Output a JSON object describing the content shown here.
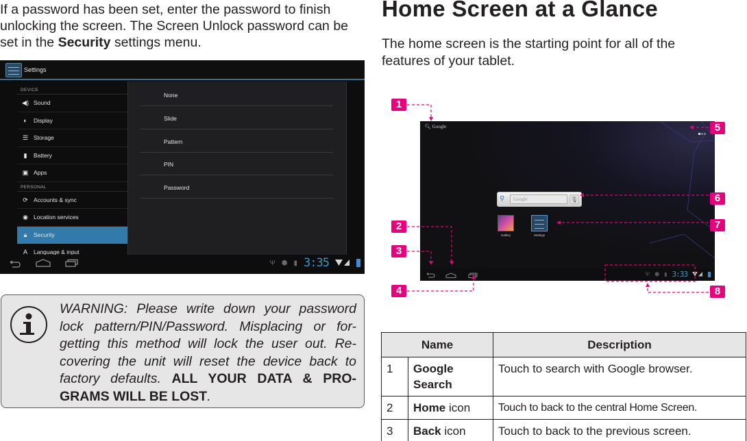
{
  "left": {
    "intro": {
      "part1": "If a password has been set, enter the password to finish unlocking the screen. The Screen Unlock password can be set in the ",
      "bold": "Security",
      "part2": " settings menu."
    },
    "settings_screenshot": {
      "actionbar_title": "Settings",
      "sections": [
        {
          "header": "DEVICE",
          "items": [
            {
              "label": "Sound",
              "icon": "speaker-icon"
            },
            {
              "label": "Display",
              "icon": "brightness-icon"
            },
            {
              "label": "Storage",
              "icon": "storage-icon"
            },
            {
              "label": "Battery",
              "icon": "battery-icon"
            },
            {
              "label": "Apps",
              "icon": "apps-icon"
            }
          ]
        },
        {
          "header": "PERSONAL",
          "items": [
            {
              "label": "Accounts & sync",
              "icon": "sync-icon"
            },
            {
              "label": "Location services",
              "icon": "location-icon"
            },
            {
              "label": "Security",
              "icon": "lock-icon",
              "selected": true
            },
            {
              "label": "Language & input",
              "icon": "language-icon"
            }
          ]
        }
      ],
      "lock_options": [
        "None",
        "Slide",
        "Pattern",
        "PIN",
        "Password"
      ],
      "status_clock": "3:35",
      "accent_color": "#317aab",
      "clock_color": "#2f9bd6"
    },
    "warning": {
      "italic_text": "WARNING: Please write down your password lock pattern/PIN/Password. Misplacing or for-getting this method will lock the user out. Re-covering the unit will reset the device back to factory defaults. ",
      "bold_text": "ALL YOUR DATA & PRO-GRAMS WILL BE LOST",
      "end": "."
    }
  },
  "right": {
    "heading": "Home Screen at a Glance",
    "subtext": "The home screen is the starting point for all of the features of your tablet.",
    "home_screenshot": {
      "google_label": "Google",
      "widget_placeholder": "Google",
      "apps": [
        {
          "label": "Gallery"
        },
        {
          "label": "Settings"
        }
      ],
      "status_clock": "3:33",
      "callouts": [
        "1",
        "2",
        "3",
        "4",
        "5",
        "6",
        "7",
        "8"
      ],
      "callout_color": "#e6007e"
    },
    "table": {
      "headers": [
        "Name",
        "Description"
      ],
      "rows": [
        {
          "num": "1",
          "name_bold": "Google Search",
          "name_rest": "",
          "desc": "Touch to search with Google browser."
        },
        {
          "num": "2",
          "name_bold": "Home",
          "name_rest": " icon",
          "desc": "Touch to back to the central Home Screen."
        },
        {
          "num": "3",
          "name_bold": "Back",
          "name_rest": " icon",
          "desc": "Touch to back to the previous screen."
        }
      ]
    }
  }
}
